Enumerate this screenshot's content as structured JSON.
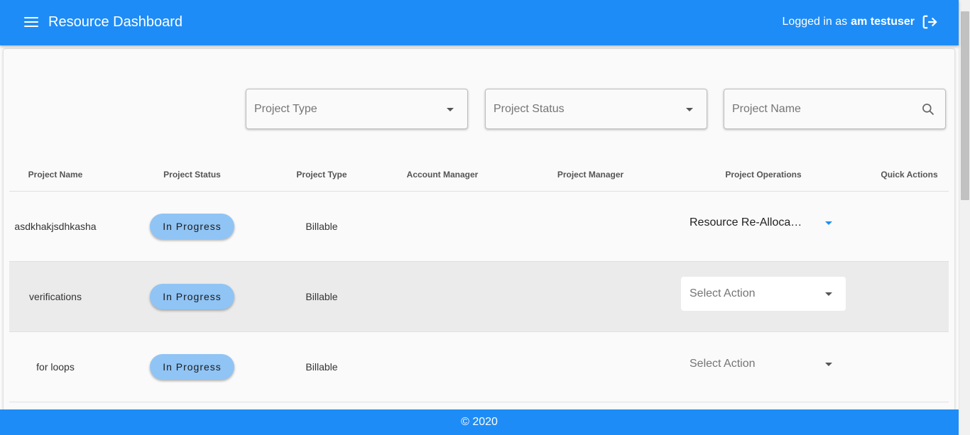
{
  "header": {
    "title": "Resource Dashboard",
    "login_prefix": "Logged in as",
    "username": "am testuser",
    "menu_icon": "menu-icon",
    "logout_icon": "logout-icon"
  },
  "filters": {
    "project_type": {
      "placeholder": "Project Type"
    },
    "project_status": {
      "placeholder": "Project Status"
    },
    "project_name": {
      "placeholder": "Project Name"
    }
  },
  "table": {
    "columns": [
      "Project Name",
      "Project Status",
      "Project Type",
      "Account Manager",
      "Project Manager",
      "Project Operations",
      "Quick Actions"
    ],
    "rows": [
      {
        "name": "asdkhakjsdhkasha",
        "status": "In Progress",
        "type": "Billable",
        "account_manager": "",
        "project_manager": "",
        "operation": "Resource Re-Allocation",
        "quick_actions": ""
      },
      {
        "name": "verifications",
        "status": "In Progress",
        "type": "Billable",
        "account_manager": "",
        "project_manager": "",
        "operation": "Select Action",
        "quick_actions": ""
      },
      {
        "name": "for loops",
        "status": "In Progress",
        "type": "Billable",
        "account_manager": "",
        "project_manager": "",
        "operation": "Select Action",
        "quick_actions": ""
      }
    ]
  },
  "footer": {
    "text": "© 2020"
  },
  "colors": {
    "primary": "#1e8cf6",
    "chip": "#90c4f5",
    "row_highlight": "#ebebeb"
  }
}
